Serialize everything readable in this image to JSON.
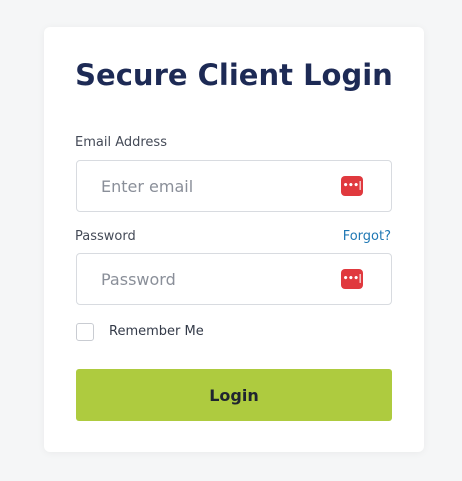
{
  "login": {
    "title": "Secure Client Login",
    "email": {
      "label": "Email Address",
      "placeholder": "Enter email",
      "value": ""
    },
    "password": {
      "label": "Password",
      "placeholder": "Password",
      "value": "",
      "forgot_link": "Forgot?"
    },
    "remember": {
      "label": "Remember Me",
      "checked": false
    },
    "submit_label": "Login",
    "password_manager_icon": "password-manager-icon"
  },
  "colors": {
    "title": "#1d2a55",
    "accent_link": "#1f78b4",
    "button": "#aecb3f",
    "password_manager": "#e0393e"
  }
}
